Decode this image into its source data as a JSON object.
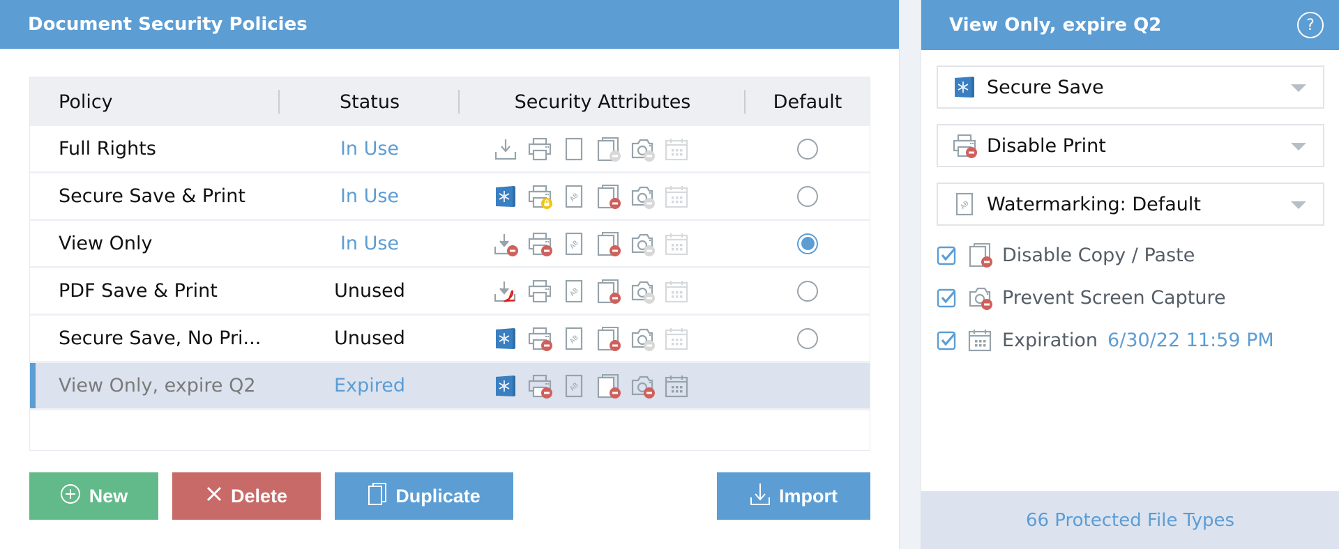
{
  "left_panel": {
    "title": "Document Security Policies",
    "table": {
      "columns": [
        "Policy",
        "Status",
        "Security Attributes",
        "Default"
      ],
      "rows": [
        {
          "policy": "Full Rights",
          "status": "In Use",
          "status_kind": "inuse",
          "default": false,
          "selected": false,
          "attributes": {
            "save": "download",
            "print": "normal",
            "watermark": "none",
            "copy": "allowed",
            "capture": "allowed",
            "expiration": "off"
          }
        },
        {
          "policy": "Secure Save & Print",
          "status": "In Use",
          "status_kind": "inuse",
          "default": false,
          "selected": false,
          "attributes": {
            "save": "secure",
            "print": "locked",
            "watermark": "ab",
            "copy": "blocked",
            "capture": "allowed",
            "expiration": "off"
          }
        },
        {
          "policy": "View Only",
          "status": "In Use",
          "status_kind": "inuse",
          "default": true,
          "selected": false,
          "attributes": {
            "save": "blocked",
            "print": "blocked",
            "watermark": "ab",
            "copy": "blocked",
            "capture": "allowed",
            "expiration": "off"
          }
        },
        {
          "policy": "PDF Save & Print",
          "status": "Unused",
          "status_kind": "unused",
          "default": false,
          "selected": false,
          "attributes": {
            "save": "pdf",
            "print": "normal",
            "watermark": "ab",
            "copy": "blocked",
            "capture": "allowed",
            "expiration": "off"
          }
        },
        {
          "policy": "Secure Save, No Pri...",
          "status": "Unused",
          "status_kind": "unused",
          "default": false,
          "selected": false,
          "attributes": {
            "save": "secure",
            "print": "blocked",
            "watermark": "ab",
            "copy": "blocked",
            "capture": "allowed",
            "expiration": "off"
          }
        },
        {
          "policy": "View Only, expire Q2",
          "status": "Expired",
          "status_kind": "expired",
          "default": null,
          "selected": true,
          "attributes": {
            "save": "secure",
            "print": "blocked",
            "watermark": "ab",
            "copy": "blocked",
            "capture": "blocked",
            "expiration": "on"
          }
        }
      ]
    },
    "buttons": {
      "new": {
        "label": "New",
        "icon": "plus-circle-icon"
      },
      "delete": {
        "label": "Delete",
        "icon": "x-icon"
      },
      "duplicate": {
        "label": "Duplicate",
        "icon": "copy-icon"
      },
      "import": {
        "label": "Import",
        "icon": "import-icon"
      }
    }
  },
  "right_panel": {
    "title": "View Only, expire Q2",
    "help_label": "?",
    "dropdowns": [
      {
        "value": "Secure Save",
        "icon": "secure-save-icon"
      },
      {
        "value": "Disable Print",
        "icon": "print-blocked-icon"
      },
      {
        "value": "Watermarking: Default",
        "icon": "watermark-icon"
      }
    ],
    "checkboxes": [
      {
        "label": "Disable Copy / Paste",
        "checked": true,
        "icon": "copy-blocked-icon"
      },
      {
        "label": "Prevent Screen Capture",
        "checked": true,
        "icon": "capture-blocked-icon"
      },
      {
        "label": "Expiration",
        "value": "6/30/22 11:59 PM",
        "checked": true,
        "icon": "calendar-icon"
      }
    ],
    "footer": "66 Protected File Types"
  },
  "colors": {
    "accent": "#5c9dd4",
    "new": "#62b98a",
    "delete": "#c86b68",
    "blocked_badge": "#d0605c",
    "locked_badge": "#f0c419",
    "selected_row": "#dce3ef"
  }
}
